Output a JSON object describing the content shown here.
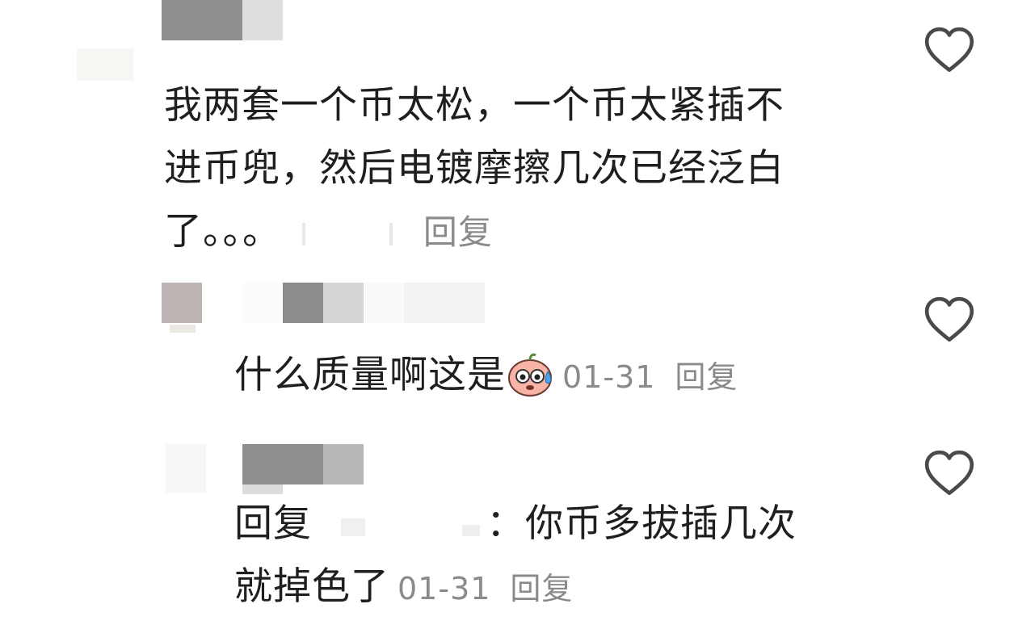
{
  "comments": [
    {
      "username": "",
      "line1": "我两套一个币太松，一个币太紧插不",
      "line2": "进币兜，然后电镀摩擦几次已经泛白",
      "line3": "了。。。",
      "date": "",
      "reply_label": "回复",
      "like_icon": "heart-outline-icon"
    },
    {
      "username": "",
      "text": "什么质量啊这是",
      "emoji": "sweat-face-emoji",
      "date": "01-31",
      "reply_label": "回复",
      "like_icon": "heart-outline-icon"
    },
    {
      "username": "",
      "reply_prefix": "回复",
      "reply_to": "",
      "colon": "：",
      "line1": "你币多拔插几次",
      "line2": "就掉色了",
      "date": "01-31",
      "reply_label": "回复",
      "like_icon": "heart-outline-icon"
    }
  ],
  "colors": {
    "text": "#1f1f1f",
    "meta": "#8a8a8a",
    "heart": "#4a4a4a",
    "mosaic_dark": "#8c8c8c",
    "mosaic_mid": "#c7c7c7",
    "mosaic_light": "#efefef"
  }
}
